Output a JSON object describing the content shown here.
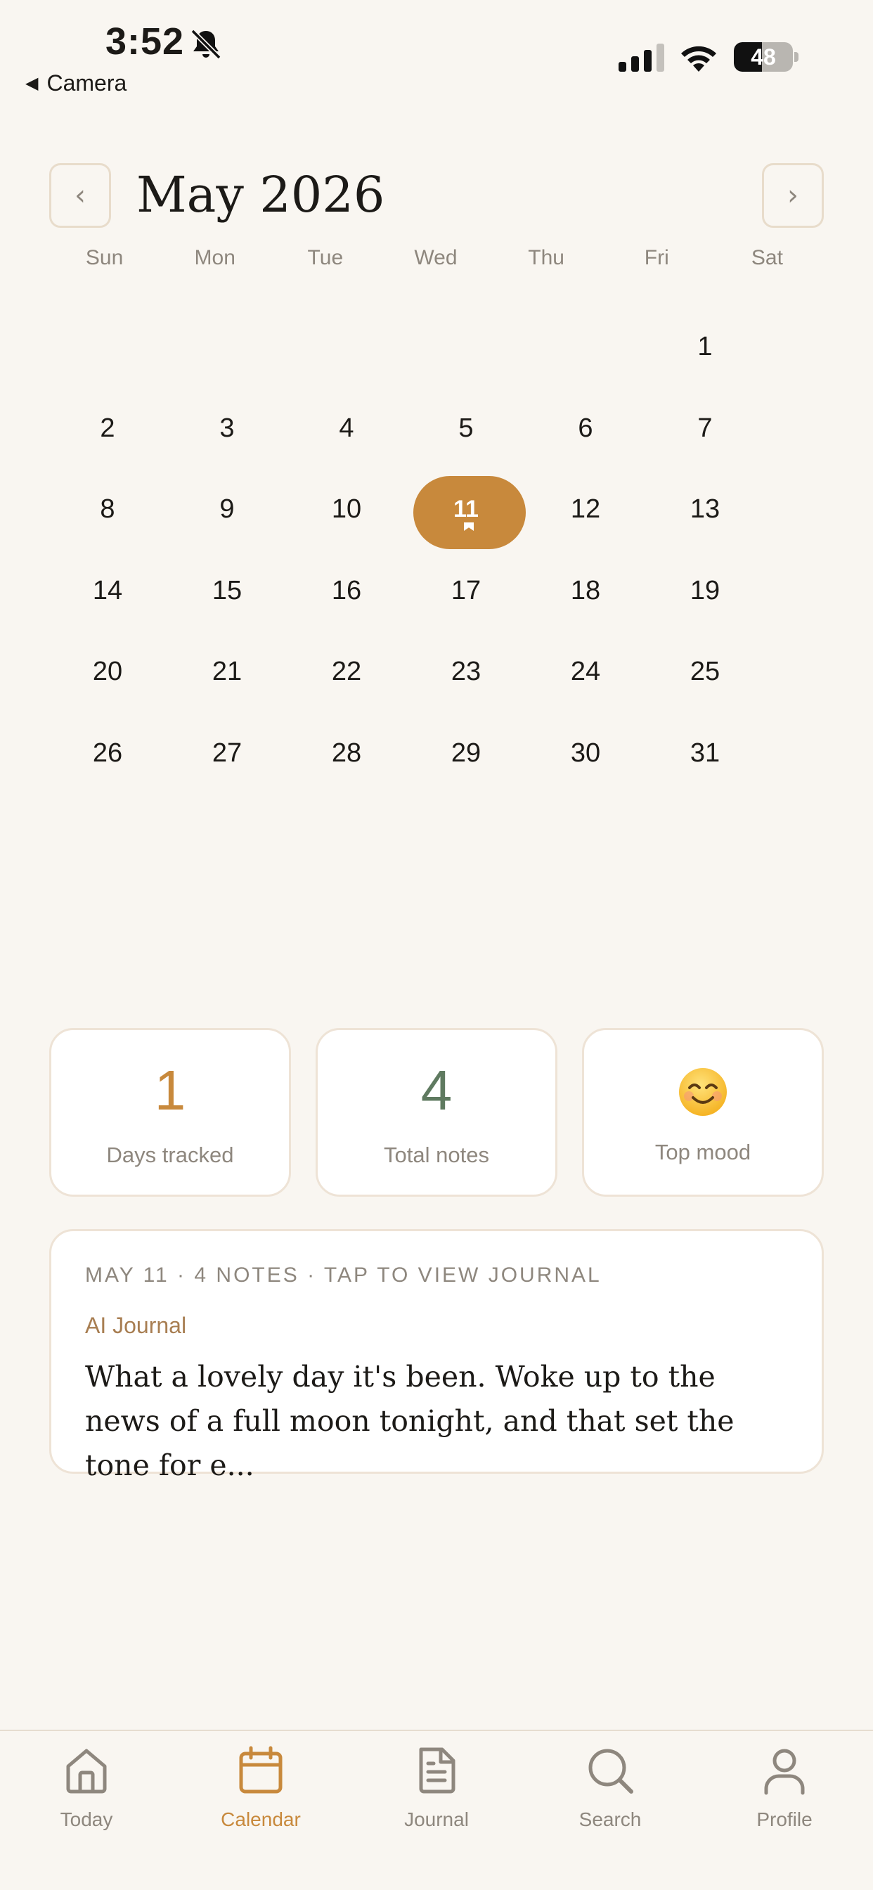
{
  "status_bar": {
    "time": "3:52",
    "back_label": "Camera",
    "battery_level": "48",
    "battery_fraction": 0.48,
    "icons": [
      "bell-slash-icon",
      "signal-icon",
      "wifi-icon",
      "battery-icon"
    ]
  },
  "calendar": {
    "month_title": "May 2026",
    "prev_icon": "chevron-left-icon",
    "next_icon": "chevron-right-icon",
    "prev_glyph": "‹",
    "next_glyph": "›",
    "weekdays": [
      "Sun",
      "Mon",
      "Tue",
      "Wed",
      "Thu",
      "Fri",
      "Sat"
    ],
    "selected_day": "11",
    "days": [
      [
        "",
        "",
        "",
        "",
        "",
        "1"
      ],
      [
        "2",
        "3",
        "4",
        "5",
        "6",
        "7"
      ],
      [
        "8",
        "9",
        "10",
        "11",
        "12",
        "13"
      ],
      [
        "14",
        "15",
        "16",
        "17",
        "18",
        "19"
      ],
      [
        "20",
        "21",
        "22",
        "23",
        "24",
        "25"
      ],
      [
        "26",
        "27",
        "28",
        "29",
        "30",
        "31"
      ]
    ]
  },
  "stats": {
    "days_tracked": {
      "value": "1",
      "label": "Days tracked"
    },
    "total_notes": {
      "value": "4",
      "label": "Total notes"
    },
    "top_mood": {
      "icon": "smiling-face-emoji",
      "label": "Top mood"
    }
  },
  "journal_card": {
    "meta": "MAY 11 · 4 NOTES · TAP TO VIEW JOURNAL",
    "source": "AI Journal",
    "excerpt": "What a lovely day it's been. Woke up to the news of a full moon tonight, and that set the tone for e..."
  },
  "tab_bar": {
    "tabs": [
      {
        "label": "Today",
        "icon": "home-icon",
        "active": false
      },
      {
        "label": "Calendar",
        "icon": "calendar-icon",
        "active": true
      },
      {
        "label": "Journal",
        "icon": "document-icon",
        "active": false
      },
      {
        "label": "Search",
        "icon": "search-icon",
        "active": false
      },
      {
        "label": "Profile",
        "icon": "person-icon",
        "active": false
      }
    ]
  },
  "colors": {
    "background": "#f9f6f1",
    "accent": "#c8893c",
    "notes_green": "#5f7a60",
    "muted_text": "#8e877e",
    "card_border": "#eee3d6"
  }
}
